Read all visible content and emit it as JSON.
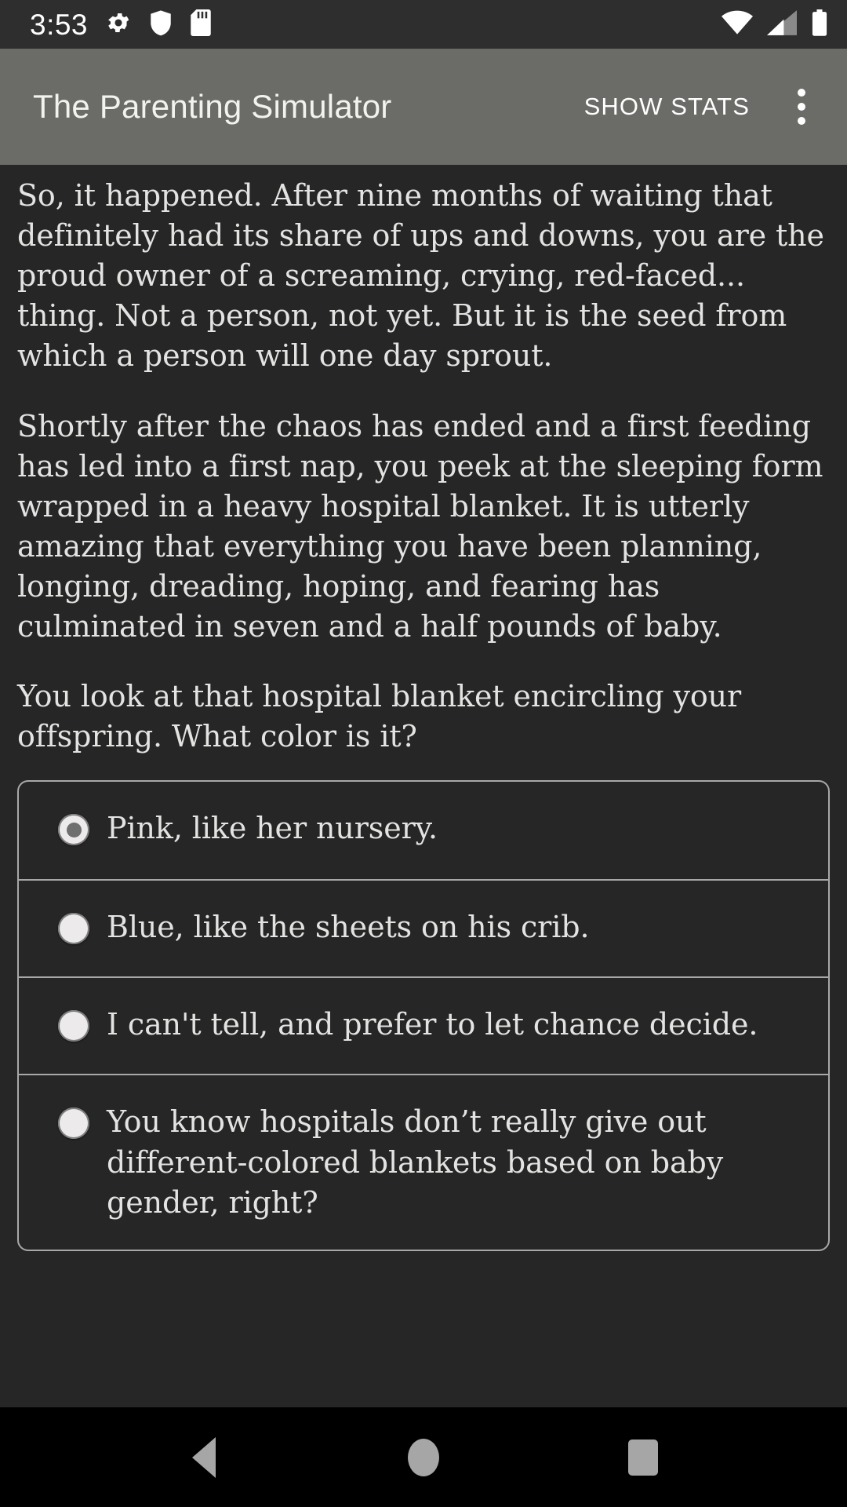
{
  "status_bar": {
    "time": "3:53",
    "left_icons": [
      "gear-icon",
      "shield-icon",
      "sd-card-icon"
    ],
    "right_icons": [
      "wifi-icon",
      "cellular-signal-icon",
      "battery-icon"
    ],
    "background_color": "#2e2e2e",
    "foreground_color": "#ffffff"
  },
  "app_bar": {
    "title": "The Parenting Simulator",
    "action_label": "SHOW STATS",
    "overflow_icon": "more-vertical-icon",
    "background_color": "#6b6b67",
    "title_color": "#f2f2ef"
  },
  "story": {
    "paragraphs": [
      "So, it happened. After nine months of waiting that definitely had its share of ups and downs, you are the proud owner of a screaming, crying, red-faced... thing. Not a person, not yet. But it is the seed from which a person will one day sprout.",
      "Shortly after the chaos has ended and a first feeding has led into a first nap, you peek at the sleeping form wrapped in a heavy hospital blanket. It is utterly amazing that everything you have been planning, longing, dreading, hoping, and fearing has culminated in seven and a half pounds of baby.",
      "You look at that hospital blanket encircling your offspring. What color is it?"
    ],
    "text_color": "#e3e3e1",
    "background_color": "#262626"
  },
  "options": {
    "border_color": "#a8a8a6",
    "items": [
      {
        "label": "Pink, like her nursery.",
        "selected": true
      },
      {
        "label": "Blue, like the sheets on his crib.",
        "selected": false
      },
      {
        "label": "I can't tell, and prefer to let chance decide.",
        "selected": false
      },
      {
        "label": "You know hospitals don’t really give out different-colored blankets based on baby gender, right?",
        "selected": false
      }
    ]
  },
  "nav_bar": {
    "background_color": "#000000",
    "icon_color": "#a6a6a6",
    "buttons": [
      {
        "name": "back-button",
        "icon": "triangle-left-icon"
      },
      {
        "name": "home-button",
        "icon": "circle-icon"
      },
      {
        "name": "recents-button",
        "icon": "square-icon"
      }
    ]
  }
}
